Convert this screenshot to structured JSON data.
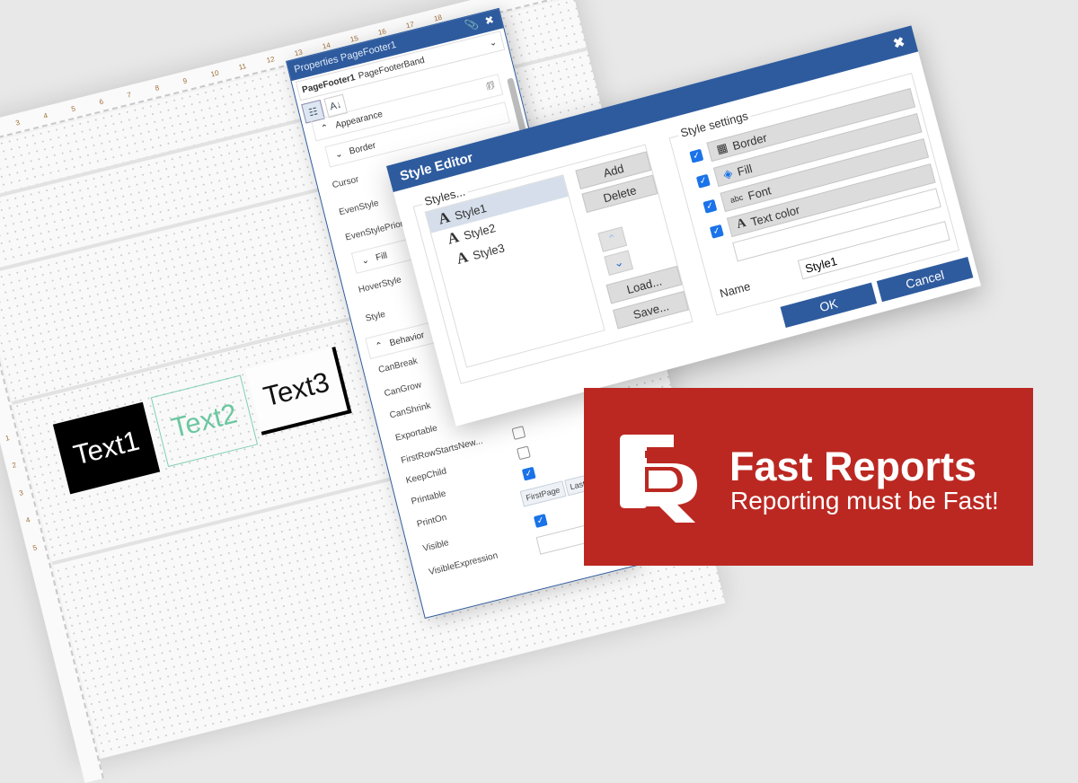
{
  "designer": {
    "ruler_top": [
      "3",
      "4",
      "5",
      "6",
      "7",
      "8",
      "9",
      "10",
      "11",
      "12",
      "13",
      "14",
      "15",
      "16",
      "17",
      "18"
    ],
    "ruler_left": [
      "1",
      "2",
      "3",
      "4",
      "5"
    ],
    "objects": [
      {
        "label": "Text1"
      },
      {
        "label": "Text2"
      },
      {
        "label": "Text3"
      }
    ]
  },
  "properties": {
    "title": "Properties PageFooter1",
    "object_name": "PageFooter1",
    "object_type": "PageFooterBand",
    "groups": {
      "appearance": "Appearance",
      "border": "Border",
      "fill": "Fill",
      "behavior": "Behavior"
    },
    "rows": {
      "cursor": "Cursor",
      "even_style": "EvenStyle",
      "even_style_priority": "EvenStylePriori",
      "hover_style": "HoverStyle",
      "style": "Style",
      "can_break": "CanBreak",
      "can_grow": "CanGrow",
      "can_shrink": "CanShrink",
      "exportable": "Exportable",
      "first_row": "FirstRowStartsNew...",
      "keep_child": "KeepChild",
      "printable": "Printable",
      "print_on": "PrintOn",
      "visible": "Visible",
      "visible_expression": "VisibleExpression"
    },
    "values": {
      "first_row": false,
      "keep_child": false,
      "printable": true,
      "visible": true,
      "print_on": [
        "FirstPage",
        "LastP"
      ]
    }
  },
  "dialog": {
    "title": "Style Editor",
    "styles_label": "Styles...",
    "styles": [
      "Style1",
      "Style2",
      "Style3"
    ],
    "selected": "Style1",
    "buttons": {
      "add": "Add",
      "delete": "Delete",
      "load": "Load...",
      "save": "Save...",
      "ok": "OK",
      "cancel": "Cancel"
    },
    "settings_label": "Style settings",
    "settings": [
      {
        "label": "Border",
        "checked": true
      },
      {
        "label": "Fill",
        "checked": true
      },
      {
        "label": "Font",
        "checked": true
      },
      {
        "label": "Text color",
        "checked": true
      }
    ],
    "font_icon_text": "abc",
    "name_label": "Name",
    "name_value": "Style1"
  },
  "banner": {
    "brand": "Fast Reports",
    "tagline": "Reporting must be Fast!",
    "logo_text": "FR",
    "color": "#bb2822"
  }
}
